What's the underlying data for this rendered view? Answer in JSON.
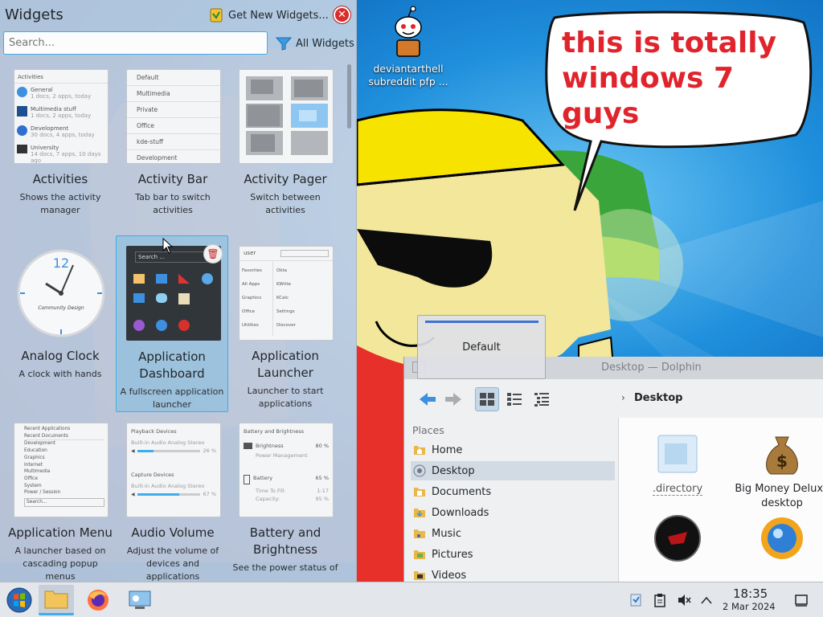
{
  "desktop": {
    "icon_label": "deviantarthell subreddit pfp ...",
    "bubble_text": "this is totally windows 7 guys"
  },
  "widgets_panel": {
    "title": "Widgets",
    "get_new_label": "Get New Widgets...",
    "search_placeholder": "Search...",
    "filter_label": "All Widgets",
    "items": [
      {
        "title": "Activities",
        "desc": "Shows the activity manager"
      },
      {
        "title": "Activity Bar",
        "desc": "Tab bar to switch activities"
      },
      {
        "title": "Activity Pager",
        "desc": "Switch between activities"
      },
      {
        "title": "Analog Clock",
        "desc": "A clock with hands"
      },
      {
        "title": "Application Dashboard",
        "desc": "A fullscreen application launcher"
      },
      {
        "title": "Application Launcher",
        "desc": "Launcher to start applications"
      },
      {
        "title": "Application Menu",
        "desc": "A launcher based on cascading popup menus"
      },
      {
        "title": "Audio Volume",
        "desc": "Adjust the volume of devices and applications"
      },
      {
        "title": "Battery and Brightness",
        "desc": "See the power status of"
      }
    ],
    "activities_thumb": {
      "header": "Activities",
      "rows": [
        {
          "name": "General",
          "sub": "1 docs, 2 apps, today"
        },
        {
          "name": "Multimedia stuff",
          "sub": "1 docs, 2 apps, today"
        },
        {
          "name": "Development",
          "sub": "30 docs, 4 apps, today"
        },
        {
          "name": "University",
          "sub": "14 docs, 7 apps, 10 days ago"
        }
      ]
    },
    "activity_bar_thumb": [
      "Default",
      "Multimedia",
      "Private",
      "Office",
      "kde-stuff",
      "Development"
    ],
    "dashboard_thumb_search": "Search ...",
    "launcher_thumb": {
      "user": "user",
      "categories": [
        "Favorites",
        "All Apps",
        "Graphics",
        "Office",
        "Utilities"
      ],
      "apps": [
        "Okta",
        "KWrite",
        "KCalc",
        "Settings",
        "Discover"
      ]
    },
    "appmenu_thumb": [
      "Recent Applications",
      "Recent Documents",
      "Development",
      "Education",
      "Graphics",
      "Internet",
      "Multimedia",
      "Office",
      "System",
      "Power / Session",
      "Search..."
    ],
    "audio_thumb": {
      "playback_header": "Playback Devices",
      "playback_device": "Built-in Audio Analog Stereo",
      "playback_pct": "26 %",
      "capture_header": "Capture Devices",
      "capture_device": "Built-in Audio Analog Stereo",
      "capture_pct": "67 %",
      "playback_level": 0.26,
      "capture_level": 0.67
    },
    "battery_thumb": {
      "header": "Battery and Brightness",
      "brightness_label": "Brightness",
      "brightness_value": "80 %",
      "power_mgmt": "Power Management",
      "battery_label": "Battery",
      "battery_value": "65 %",
      "time_label": "Time To Fill:",
      "time_value": "1:17",
      "capacity_label": "Capacity:",
      "capacity_value": "95 %"
    },
    "clock_thumb_text": "Community Design"
  },
  "activity_popup": {
    "label": "Default"
  },
  "dolphin": {
    "title": "Desktop — Dolphin",
    "breadcrumb": "Desktop",
    "places_header": "Places",
    "places": [
      "Home",
      "Desktop",
      "Documents",
      "Downloads",
      "Music",
      "Pictures",
      "Videos"
    ],
    "files": [
      ".directory",
      "Big Money Deluxe desktop"
    ]
  },
  "taskbar": {
    "time": "18:35",
    "date": "2 Mar 2024"
  },
  "colors": {
    "accent": "#3daee9",
    "bubble_text": "#e0242c",
    "close_red": "#d92d2d"
  }
}
